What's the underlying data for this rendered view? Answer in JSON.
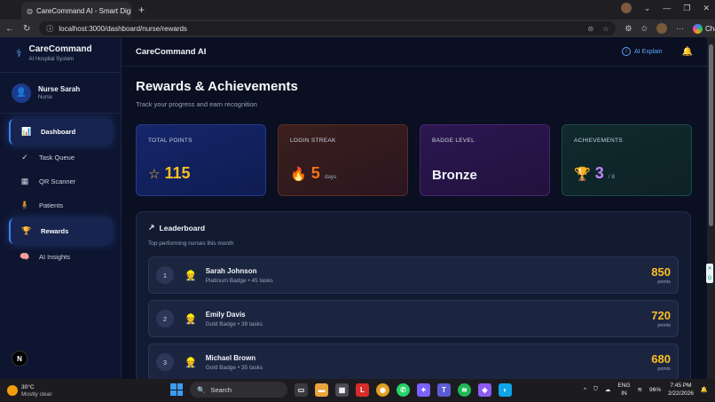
{
  "browser": {
    "tab_title": "CareCommand AI - Smart Digital I",
    "url": "localhost:3000/dashboard/nurse/rewards",
    "chat_label": "Chat"
  },
  "sidebar": {
    "brand_title": "CareCommand",
    "brand_subtitle": "AI Hospital System",
    "user_name": "Nurse Sarah",
    "user_role": "Nurse",
    "items": [
      {
        "label": "Dashboard",
        "icon": "chart-icon",
        "active": true
      },
      {
        "label": "Task Queue",
        "icon": "check-icon",
        "active": false
      },
      {
        "label": "QR Scanner",
        "icon": "qr-icon",
        "active": false
      },
      {
        "label": "Patients",
        "icon": "patients-icon",
        "active": false
      },
      {
        "label": "Rewards",
        "icon": "trophy-icon",
        "active": true
      },
      {
        "label": "AI Insights",
        "icon": "brain-icon",
        "active": false
      }
    ],
    "n_badge": "N"
  },
  "topbar": {
    "title": "CareCommand AI",
    "ai_explain": "AI Explain"
  },
  "page": {
    "title": "Rewards & Achievements",
    "subtitle": "Track your progress and earn recognition"
  },
  "stats": {
    "total_points": {
      "label": "TOTAL POINTS",
      "value": "115"
    },
    "login_streak": {
      "label": "LOGIN STREAK",
      "value": "5",
      "unit": "days"
    },
    "badge_level": {
      "label": "BADGE LEVEL",
      "value": "Bronze"
    },
    "achievements": {
      "label": "ACHIEVEMENTS",
      "value": "3",
      "unit": "/ 8"
    }
  },
  "leaderboard": {
    "title": "Leaderboard",
    "subtitle": "Top performing nurses this month",
    "points_label": "points",
    "rows": [
      {
        "rank": "1",
        "name": "Sarah Johnson",
        "meta": "Platinum Badge • 45 tasks",
        "points": "850"
      },
      {
        "rank": "2",
        "name": "Emily Davis",
        "meta": "Gold Badge • 38 tasks",
        "points": "720"
      },
      {
        "rank": "3",
        "name": "Michael Brown",
        "meta": "Gold Badge • 35 tasks",
        "points": "680"
      }
    ]
  },
  "taskbar": {
    "temp": "30°C",
    "condition": "Mostly clear",
    "search": "Search",
    "lang_1": "ENG",
    "lang_2": "IN",
    "battery": "96%",
    "time": "7:45 PM",
    "date": "2/22/2026"
  }
}
